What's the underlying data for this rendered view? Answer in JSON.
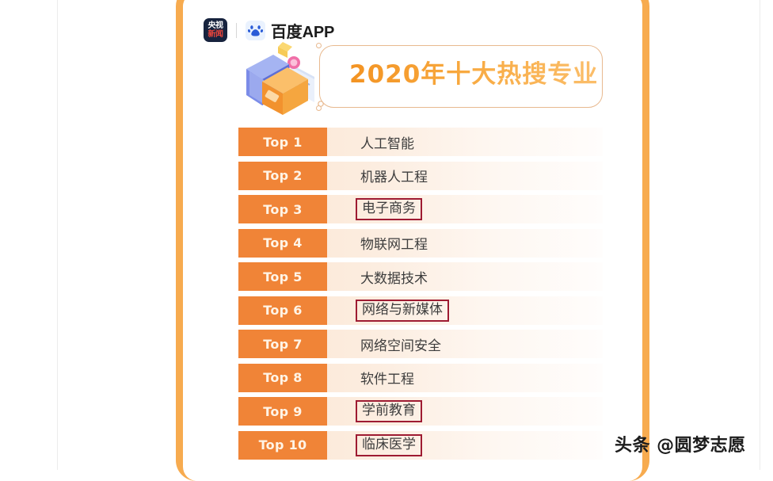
{
  "brand": {
    "cctv_logo": {
      "name": "cctv-news-logo",
      "line1": "央视",
      "line2": "新闻"
    },
    "baidu": {
      "icon_name": "baidu-paw-icon",
      "label": "百度APP"
    }
  },
  "header": {
    "title": "2020年十大热搜专业",
    "illustration_name": "books-and-screen-illustration"
  },
  "list": {
    "rows": [
      {
        "rank": "Top 1",
        "major": "人工智能",
        "highlighted": false
      },
      {
        "rank": "Top 2",
        "major": "机器人工程",
        "highlighted": false
      },
      {
        "rank": "Top 3",
        "major": "电子商务",
        "highlighted": true
      },
      {
        "rank": "Top 4",
        "major": "物联网工程",
        "highlighted": false
      },
      {
        "rank": "Top 5",
        "major": "大数据技术",
        "highlighted": false
      },
      {
        "rank": "Top 6",
        "major": "网络与新媒体",
        "highlighted": true
      },
      {
        "rank": "Top 7",
        "major": "网络空间安全",
        "highlighted": false
      },
      {
        "rank": "Top 8",
        "major": "软件工程",
        "highlighted": false
      },
      {
        "rank": "Top 9",
        "major": "学前教育",
        "highlighted": true
      },
      {
        "rank": "Top 10",
        "major": "临床医学",
        "highlighted": true
      }
    ]
  },
  "watermark": {
    "text": "头条 @圆梦志愿"
  },
  "colors": {
    "frame_orange": "#F7AB4F",
    "badge_orange": "#F08437",
    "title_orange": "#F39322",
    "highlight_red": "#9E1B32",
    "row_peach": "#FBE6D2"
  }
}
